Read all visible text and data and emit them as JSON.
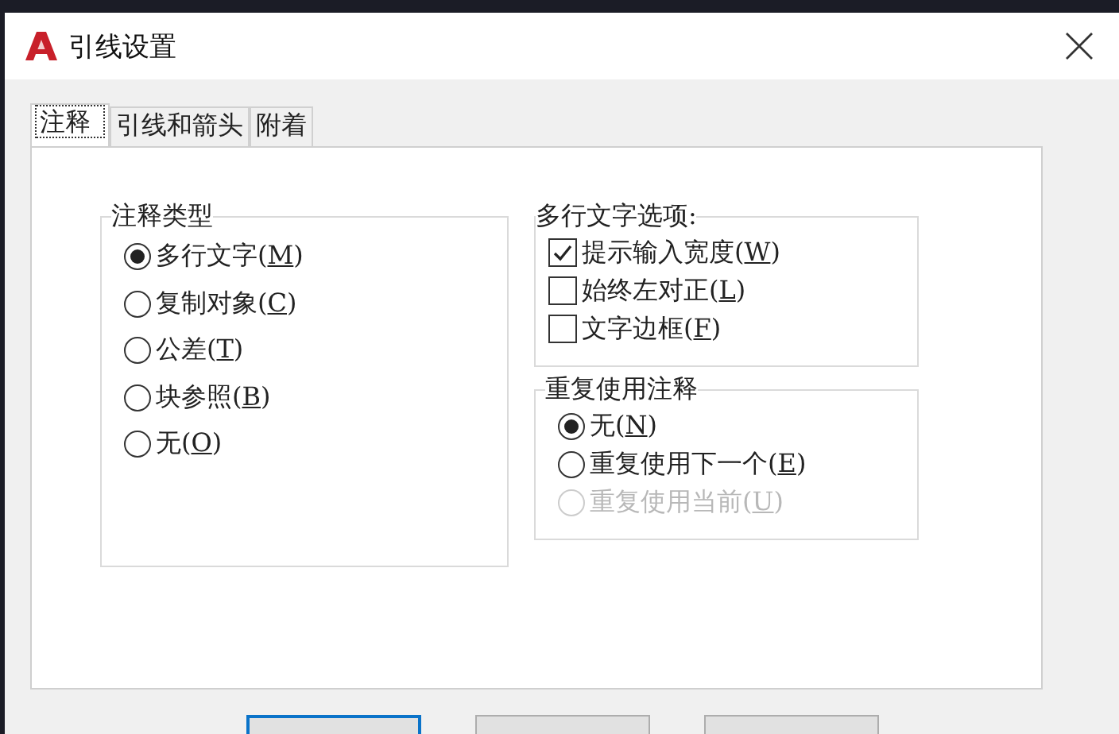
{
  "window": {
    "title": "引线设置"
  },
  "tabs": [
    {
      "label": "注释",
      "selected": true
    },
    {
      "label": "引线和箭头",
      "selected": false
    },
    {
      "label": "附着",
      "selected": false
    }
  ],
  "annotation_type": {
    "title": "注释类型",
    "options": [
      {
        "before": "多行文字(",
        "key": "M",
        "after": ")",
        "selected": true
      },
      {
        "before": "复制对象(",
        "key": "C",
        "after": ")",
        "selected": false
      },
      {
        "before": "公差(",
        "key": "T",
        "after": ")",
        "selected": false
      },
      {
        "before": "块参照(",
        "key": "B",
        "after": ")",
        "selected": false
      },
      {
        "before": "无(",
        "key": "O",
        "after": ")",
        "selected": false
      }
    ]
  },
  "mtext_options": {
    "title": "多行文字选项:",
    "options": [
      {
        "before": "提示输入宽度(",
        "key": "W",
        "after": ")",
        "checked": true
      },
      {
        "before": "始终左对正(",
        "key": "L",
        "after": ")",
        "checked": false
      },
      {
        "before": "文字边框(",
        "key": "F",
        "after": ")",
        "checked": false
      }
    ]
  },
  "reuse_annotation": {
    "title": "重复使用注释",
    "options": [
      {
        "before": "无(",
        "key": "N",
        "after": ")",
        "selected": true,
        "disabled": false
      },
      {
        "before": "重复使用下一个(",
        "key": "E",
        "after": ")",
        "selected": false,
        "disabled": false
      },
      {
        "before": "重复使用当前(",
        "key": "U",
        "after": ")",
        "selected": false,
        "disabled": true
      }
    ]
  },
  "buttons": [
    {
      "kind": "default"
    },
    {
      "kind": "normal"
    },
    {
      "kind": "normal"
    }
  ]
}
